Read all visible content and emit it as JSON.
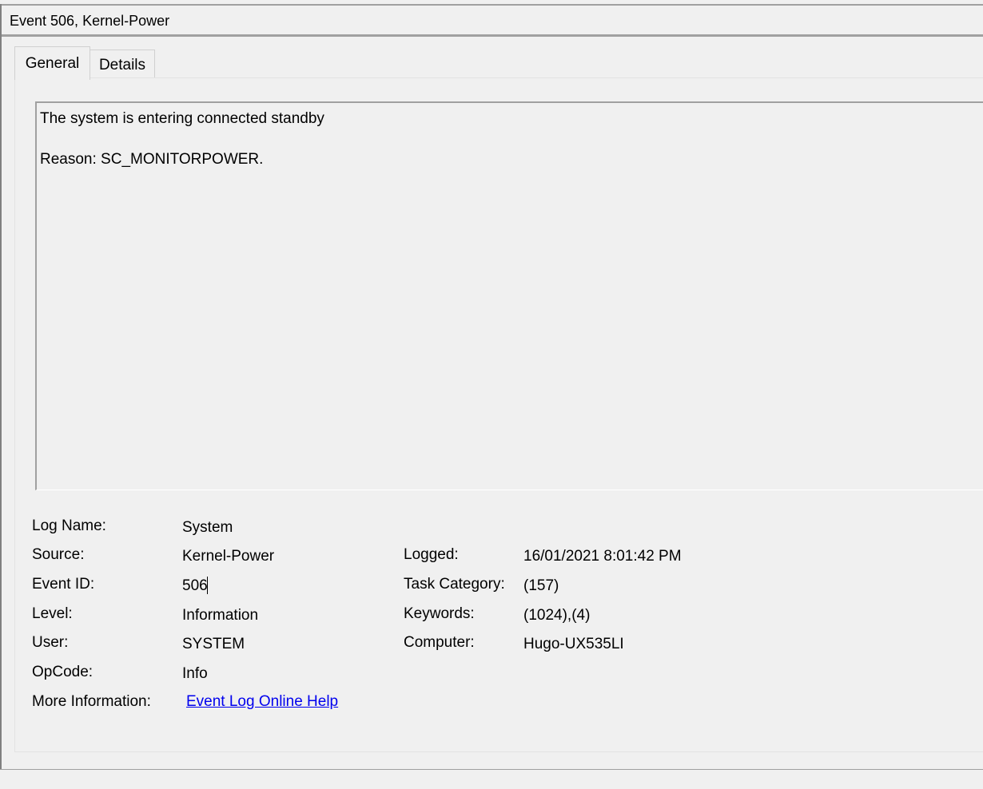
{
  "window": {
    "title": "Event 506, Kernel-Power"
  },
  "tabs": [
    {
      "label": "General",
      "selected": true
    },
    {
      "label": "Details",
      "selected": false
    }
  ],
  "description": {
    "line1": "The system is entering connected standby",
    "line2": "Reason: SC_MONITORPOWER."
  },
  "properties": {
    "log_name": {
      "label": "Log Name:",
      "value": "System"
    },
    "source": {
      "label": "Source:",
      "value": "Kernel-Power"
    },
    "event_id": {
      "label": "Event ID:",
      "value": "506"
    },
    "level": {
      "label": "Level:",
      "value": "Information"
    },
    "user": {
      "label": "User:",
      "value": "SYSTEM"
    },
    "opcode": {
      "label": "OpCode:",
      "value": "Info"
    },
    "more_info": {
      "label": "More Information:",
      "link": "Event Log Online Help"
    },
    "logged": {
      "label": "Logged:",
      "value": "16/01/2021 8:01:42 PM"
    },
    "task_category": {
      "label": "Task Category:",
      "value": "(157)"
    },
    "keywords": {
      "label": "Keywords:",
      "value": "(1024),(4)"
    },
    "computer": {
      "label": "Computer:",
      "value": "Hugo-UX535LI"
    }
  },
  "colors": {
    "background": "#f0f0f0",
    "border": "#a0a0a0",
    "link": "#0000ee"
  }
}
